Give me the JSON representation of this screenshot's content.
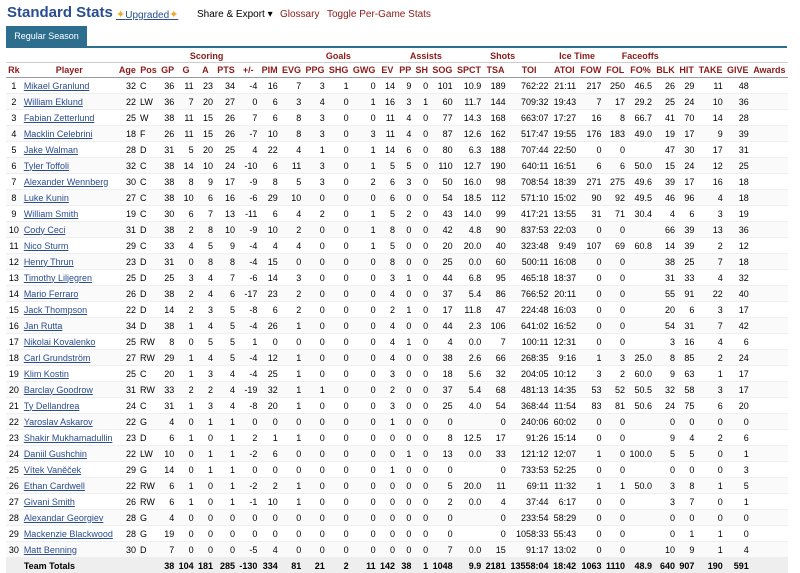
{
  "header": {
    "title": "Standard Stats",
    "upgraded_label": "Upgraded",
    "share_export_label": "Share & Export ▾",
    "glossary_label": "Glossary",
    "toggle_label": "Toggle Per-Game Stats"
  },
  "tabs": [
    {
      "label": "Regular Season"
    }
  ],
  "table": {
    "groups": [
      "",
      "Scoring",
      "",
      "Goals",
      "Assists",
      "Shots",
      "Ice Time",
      "Faceoffs",
      ""
    ],
    "group_spans": [
      5,
      3,
      2,
      5,
      3,
      3,
      2,
      3,
      6
    ],
    "columns": [
      "Rk",
      "Player",
      "Age",
      "Pos",
      "GP",
      "G",
      "A",
      "PTS",
      "+/-",
      "PIM",
      "EVG",
      "PPG",
      "SHG",
      "GWG",
      "EV",
      "PP",
      "SH",
      "SOG",
      "SPCT",
      "TSA",
      "TOI",
      "ATOI",
      "FOW",
      "FOL",
      "FO%",
      "BLK",
      "HIT",
      "TAKE",
      "GIVE",
      "Awards"
    ],
    "rows": [
      [
        "1",
        "Mikael Granlund",
        "32",
        "C",
        "36",
        "11",
        "23",
        "34",
        "-4",
        "16",
        "7",
        "3",
        "1",
        "0",
        "14",
        "9",
        "0",
        "101",
        "10.9",
        "189",
        "762:22",
        "21:11",
        "217",
        "250",
        "46.5",
        "26",
        "29",
        "11",
        "48",
        ""
      ],
      [
        "2",
        "William Eklund",
        "22",
        "LW",
        "36",
        "7",
        "20",
        "27",
        "0",
        "6",
        "3",
        "4",
        "0",
        "1",
        "16",
        "3",
        "1",
        "60",
        "11.7",
        "144",
        "709:32",
        "19:43",
        "7",
        "17",
        "29.2",
        "25",
        "24",
        "10",
        "36",
        ""
      ],
      [
        "3",
        "Fabian Zetterlund",
        "25",
        "W",
        "38",
        "11",
        "15",
        "26",
        "7",
        "6",
        "8",
        "3",
        "0",
        "0",
        "11",
        "4",
        "0",
        "77",
        "14.3",
        "168",
        "663:07",
        "17:27",
        "16",
        "8",
        "66.7",
        "41",
        "70",
        "14",
        "28",
        ""
      ],
      [
        "4",
        "Macklin Celebrini",
        "18",
        "F",
        "26",
        "11",
        "15",
        "26",
        "-7",
        "10",
        "8",
        "3",
        "0",
        "3",
        "11",
        "4",
        "0",
        "87",
        "12.6",
        "162",
        "517:47",
        "19:55",
        "176",
        "183",
        "49.0",
        "19",
        "17",
        "9",
        "39",
        ""
      ],
      [
        "5",
        "Jake Walman",
        "28",
        "D",
        "31",
        "5",
        "20",
        "25",
        "4",
        "22",
        "4",
        "1",
        "0",
        "1",
        "14",
        "6",
        "0",
        "80",
        "6.3",
        "188",
        "707:44",
        "22:50",
        "0",
        "0",
        "",
        "47",
        "30",
        "17",
        "31",
        ""
      ],
      [
        "6",
        "Tyler Toffoli",
        "32",
        "C",
        "38",
        "14",
        "10",
        "24",
        "-10",
        "6",
        "11",
        "3",
        "0",
        "1",
        "5",
        "5",
        "0",
        "110",
        "12.7",
        "190",
        "640:11",
        "16:51",
        "6",
        "6",
        "50.0",
        "15",
        "24",
        "12",
        "25",
        ""
      ],
      [
        "7",
        "Alexander Wennberg",
        "30",
        "C",
        "38",
        "8",
        "9",
        "17",
        "-9",
        "8",
        "5",
        "3",
        "0",
        "2",
        "6",
        "3",
        "0",
        "50",
        "16.0",
        "98",
        "708:54",
        "18:39",
        "271",
        "275",
        "49.6",
        "39",
        "17",
        "16",
        "18",
        ""
      ],
      [
        "8",
        "Luke Kunin",
        "27",
        "C",
        "38",
        "10",
        "6",
        "16",
        "-6",
        "29",
        "10",
        "0",
        "0",
        "0",
        "6",
        "0",
        "0",
        "54",
        "18.5",
        "112",
        "571:10",
        "15:02",
        "90",
        "92",
        "49.5",
        "46",
        "96",
        "4",
        "18",
        ""
      ],
      [
        "9",
        "William Smith",
        "19",
        "C",
        "30",
        "6",
        "7",
        "13",
        "-11",
        "6",
        "4",
        "2",
        "0",
        "1",
        "5",
        "2",
        "0",
        "43",
        "14.0",
        "99",
        "417:21",
        "13:55",
        "31",
        "71",
        "30.4",
        "4",
        "6",
        "3",
        "19",
        ""
      ],
      [
        "10",
        "Cody Ceci",
        "31",
        "D",
        "38",
        "2",
        "8",
        "10",
        "-9",
        "10",
        "2",
        "0",
        "0",
        "1",
        "8",
        "0",
        "0",
        "42",
        "4.8",
        "90",
        "837:53",
        "22:03",
        "0",
        "0",
        "",
        "66",
        "39",
        "13",
        "36",
        ""
      ],
      [
        "11",
        "Nico Sturm",
        "29",
        "C",
        "33",
        "4",
        "5",
        "9",
        "-4",
        "4",
        "4",
        "0",
        "0",
        "1",
        "5",
        "0",
        "0",
        "20",
        "20.0",
        "40",
        "323:48",
        "9:49",
        "107",
        "69",
        "60.8",
        "14",
        "39",
        "2",
        "12",
        ""
      ],
      [
        "12",
        "Henry Thrun",
        "23",
        "D",
        "31",
        "0",
        "8",
        "8",
        "-4",
        "15",
        "0",
        "0",
        "0",
        "0",
        "8",
        "0",
        "0",
        "25",
        "0.0",
        "60",
        "500:11",
        "16:08",
        "0",
        "0",
        "",
        "38",
        "25",
        "7",
        "18",
        ""
      ],
      [
        "13",
        "Timothy Liljegren",
        "25",
        "D",
        "25",
        "3",
        "4",
        "7",
        "-6",
        "14",
        "3",
        "0",
        "0",
        "0",
        "3",
        "1",
        "0",
        "44",
        "6.8",
        "95",
        "465:18",
        "18:37",
        "0",
        "0",
        "",
        "31",
        "33",
        "4",
        "32",
        ""
      ],
      [
        "14",
        "Mario Ferraro",
        "26",
        "D",
        "38",
        "2",
        "4",
        "6",
        "-17",
        "23",
        "2",
        "0",
        "0",
        "0",
        "4",
        "0",
        "0",
        "37",
        "5.4",
        "86",
        "766:52",
        "20:11",
        "0",
        "0",
        "",
        "55",
        "91",
        "22",
        "40",
        ""
      ],
      [
        "15",
        "Jack Thompson",
        "22",
        "D",
        "14",
        "2",
        "3",
        "5",
        "-8",
        "6",
        "2",
        "0",
        "0",
        "0",
        "2",
        "1",
        "0",
        "17",
        "11.8",
        "47",
        "224:48",
        "16:03",
        "0",
        "0",
        "",
        "20",
        "6",
        "3",
        "17",
        ""
      ],
      [
        "16",
        "Jan Rutta",
        "34",
        "D",
        "38",
        "1",
        "4",
        "5",
        "-4",
        "26",
        "1",
        "0",
        "0",
        "0",
        "4",
        "0",
        "0",
        "44",
        "2.3",
        "106",
        "641:02",
        "16:52",
        "0",
        "0",
        "",
        "54",
        "31",
        "7",
        "42",
        ""
      ],
      [
        "17",
        "Nikolai Kovalenko",
        "25",
        "RW",
        "8",
        "0",
        "5",
        "5",
        "1",
        "0",
        "0",
        "0",
        "0",
        "0",
        "4",
        "1",
        "0",
        "4",
        "0.0",
        "7",
        "100:11",
        "12:31",
        "0",
        "0",
        "",
        "3",
        "16",
        "4",
        "6",
        ""
      ],
      [
        "18",
        "Carl Grundström",
        "27",
        "RW",
        "29",
        "1",
        "4",
        "5",
        "-4",
        "12",
        "1",
        "0",
        "0",
        "0",
        "4",
        "0",
        "0",
        "38",
        "2.6",
        "66",
        "268:35",
        "9:16",
        "1",
        "3",
        "25.0",
        "8",
        "85",
        "2",
        "24",
        ""
      ],
      [
        "19",
        "Klim Kostin",
        "25",
        "C",
        "20",
        "1",
        "3",
        "4",
        "-4",
        "25",
        "1",
        "0",
        "0",
        "0",
        "3",
        "0",
        "0",
        "18",
        "5.6",
        "32",
        "204:05",
        "10:12",
        "3",
        "2",
        "60.0",
        "9",
        "63",
        "1",
        "17",
        ""
      ],
      [
        "20",
        "Barclay Goodrow",
        "31",
        "RW",
        "33",
        "2",
        "2",
        "4",
        "-19",
        "32",
        "1",
        "1",
        "0",
        "0",
        "2",
        "0",
        "0",
        "37",
        "5.4",
        "68",
        "481:13",
        "14:35",
        "53",
        "52",
        "50.5",
        "32",
        "58",
        "3",
        "17",
        ""
      ],
      [
        "21",
        "Ty Dellandrea",
        "24",
        "C",
        "31",
        "1",
        "3",
        "4",
        "-8",
        "20",
        "1",
        "0",
        "0",
        "0",
        "3",
        "0",
        "0",
        "25",
        "4.0",
        "54",
        "368:44",
        "11:54",
        "83",
        "81",
        "50.6",
        "24",
        "75",
        "6",
        "20",
        ""
      ],
      [
        "22",
        "Yaroslav Askarov",
        "22",
        "G",
        "4",
        "0",
        "1",
        "1",
        "0",
        "0",
        "0",
        "0",
        "0",
        "0",
        "1",
        "0",
        "0",
        "0",
        "",
        "0",
        "240:06",
        "60:02",
        "0",
        "0",
        "",
        "0",
        "0",
        "0",
        "0",
        ""
      ],
      [
        "23",
        "Shakir Mukhamadullin",
        "23",
        "D",
        "6",
        "1",
        "0",
        "1",
        "2",
        "1",
        "1",
        "0",
        "0",
        "0",
        "0",
        "0",
        "0",
        "8",
        "12.5",
        "17",
        "91:26",
        "15:14",
        "0",
        "0",
        "",
        "9",
        "4",
        "2",
        "6",
        ""
      ],
      [
        "24",
        "Daniil Gushchin",
        "22",
        "LW",
        "10",
        "0",
        "1",
        "1",
        "-2",
        "6",
        "0",
        "0",
        "0",
        "0",
        "0",
        "1",
        "0",
        "13",
        "0.0",
        "33",
        "121:12",
        "12:07",
        "1",
        "0",
        "100.0",
        "5",
        "5",
        "0",
        "1",
        ""
      ],
      [
        "25",
        "Vítek Vaněček",
        "29",
        "G",
        "14",
        "0",
        "1",
        "1",
        "0",
        "0",
        "0",
        "0",
        "0",
        "0",
        "1",
        "0",
        "0",
        "0",
        "",
        "0",
        "733:53",
        "52:25",
        "0",
        "0",
        "",
        "0",
        "0",
        "0",
        "3",
        ""
      ],
      [
        "26",
        "Ethan Cardwell",
        "22",
        "RW",
        "6",
        "1",
        "0",
        "1",
        "-2",
        "2",
        "1",
        "0",
        "0",
        "0",
        "0",
        "0",
        "0",
        "5",
        "20.0",
        "11",
        "69:11",
        "11:32",
        "1",
        "1",
        "50.0",
        "3",
        "8",
        "1",
        "5",
        ""
      ],
      [
        "27",
        "Givani Smith",
        "26",
        "RW",
        "6",
        "1",
        "0",
        "1",
        "-1",
        "10",
        "1",
        "0",
        "0",
        "0",
        "0",
        "0",
        "0",
        "2",
        "0.0",
        "4",
        "37:44",
        "6:17",
        "0",
        "0",
        "",
        "3",
        "7",
        "0",
        "1",
        ""
      ],
      [
        "28",
        "Alexandar Georgiev",
        "28",
        "G",
        "4",
        "0",
        "0",
        "0",
        "0",
        "0",
        "0",
        "0",
        "0",
        "0",
        "0",
        "0",
        "0",
        "0",
        "",
        "0",
        "233:54",
        "58:29",
        "0",
        "0",
        "",
        "0",
        "0",
        "0",
        "0",
        ""
      ],
      [
        "29",
        "Mackenzie Blackwood",
        "28",
        "G",
        "19",
        "0",
        "0",
        "0",
        "0",
        "0",
        "0",
        "0",
        "0",
        "0",
        "0",
        "0",
        "0",
        "0",
        "",
        "0",
        "1058:33",
        "55:43",
        "0",
        "0",
        "",
        "0",
        "1",
        "1",
        "0",
        ""
      ],
      [
        "30",
        "Matt Benning",
        "30",
        "D",
        "7",
        "0",
        "0",
        "0",
        "-5",
        "4",
        "0",
        "0",
        "0",
        "0",
        "0",
        "0",
        "0",
        "7",
        "0.0",
        "15",
        "91:17",
        "13:02",
        "0",
        "0",
        "",
        "10",
        "9",
        "1",
        "4",
        ""
      ]
    ],
    "totals": [
      "",
      "Team Totals",
      "",
      "",
      "38",
      "104",
      "181",
      "285",
      "-130",
      "334",
      "81",
      "21",
      "2",
      "11",
      "142",
      "38",
      "1",
      "1048",
      "9.9",
      "2181",
      "13558:04",
      "18:42",
      "1063",
      "1110",
      "48.9",
      "640",
      "907",
      "190",
      "591",
      ""
    ]
  }
}
